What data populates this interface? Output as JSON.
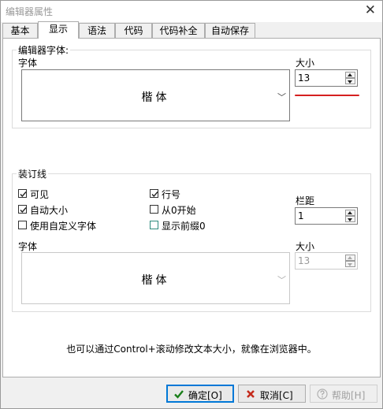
{
  "window": {
    "title": "编辑器属性"
  },
  "tabs": [
    {
      "label": "基本"
    },
    {
      "label": "显示"
    },
    {
      "label": "语法"
    },
    {
      "label": "代码"
    },
    {
      "label": "代码补全"
    },
    {
      "label": "自动保存"
    }
  ],
  "editor_font": {
    "group_title": "编辑器字体:",
    "font_label": "字体",
    "font_value": "楷体",
    "size_label": "大小",
    "size_value": "13"
  },
  "gutter": {
    "group_title": "装订线",
    "checkboxes": {
      "visible": {
        "label": "可见",
        "checked": true
      },
      "line_numbers": {
        "label": "行号",
        "checked": true
      },
      "auto_size": {
        "label": "自动大小",
        "checked": true
      },
      "start_zero": {
        "label": "从0开始",
        "checked": false
      },
      "custom_font": {
        "label": "使用自定义字体",
        "checked": false
      },
      "leading_zeros": {
        "label": "显示前缀0",
        "checked": false
      }
    },
    "margin_label": "栏距",
    "margin_value": "1",
    "font_label": "字体",
    "font_value": "楷体",
    "size_label": "大小",
    "size_value": "13"
  },
  "hint": "也可以通过Control+滚动修改文本大小，就像在浏览器中。",
  "buttons": {
    "ok": "确定[O]",
    "cancel": "取消[C]",
    "help": "帮助[H]"
  },
  "colors": {
    "accent_line": "#d52020",
    "focus_border": "#0078d7",
    "ok_check": "#1a7f1a",
    "cancel_x": "#c42b1c"
  }
}
